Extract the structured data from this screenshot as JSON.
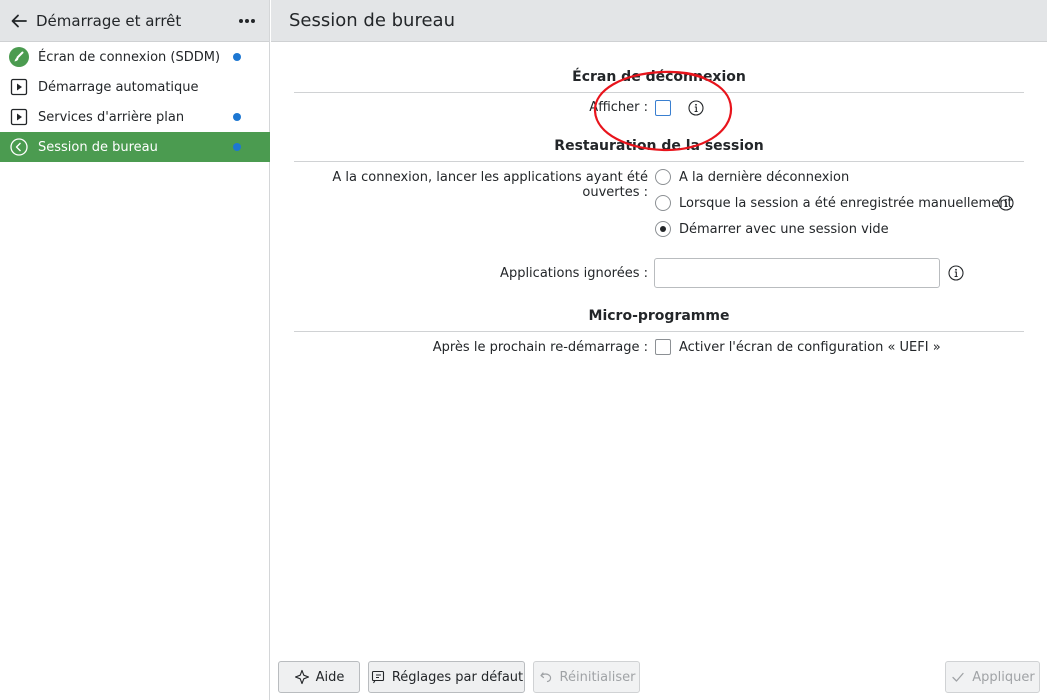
{
  "sidebar": {
    "title": "Démarrage et arrêt",
    "items": [
      {
        "label": "Écran de connexion (SDDM)",
        "icon": "brush-icon",
        "dot": true
      },
      {
        "label": "Démarrage automatique",
        "icon": "play-box-icon",
        "dot": false
      },
      {
        "label": "Services d'arrière plan",
        "icon": "play-box-icon",
        "dot": true
      },
      {
        "label": "Session de bureau",
        "icon": "chevron-left-circle-icon",
        "dot": true,
        "active": true
      }
    ]
  },
  "main": {
    "title": "Session de bureau",
    "logout_section": {
      "title": "Écran de déconnexion",
      "show_label": "Afficher :",
      "show_checked": false
    },
    "restore_section": {
      "title": "Restauration de la session",
      "label": "A la connexion, lancer les applications ayant été ouvertes :",
      "options": [
        {
          "label": "A la dernière déconnexion",
          "checked": false
        },
        {
          "label": "Lorsque la session a été enregistrée manuellement",
          "checked": false
        },
        {
          "label": "Démarrer avec une session vide",
          "checked": true
        }
      ],
      "ignored_label": "Applications ignorées :",
      "ignored_value": ""
    },
    "firmware_section": {
      "title": "Micro-programme",
      "label": "Après le prochain re-démarrage :",
      "uefi_label": "Activer l'écran de configuration « UEFI »",
      "uefi_checked": false
    }
  },
  "buttons": {
    "help": "Aide",
    "defaults": "Réglages par défaut",
    "reset": "Réinitialiser",
    "apply": "Appliquer"
  },
  "colors": {
    "accent": "#4b9b50",
    "dot": "#1d77d2",
    "annotation": "#e8141c"
  }
}
